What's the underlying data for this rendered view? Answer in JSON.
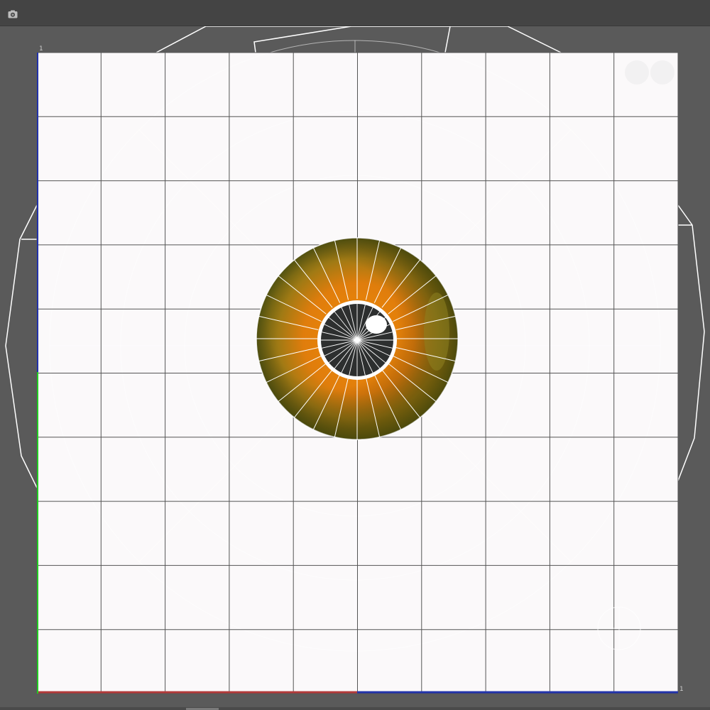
{
  "toolbar": {
    "snapshot_icon": "camera-icon"
  },
  "uv_editor": {
    "tile_label_top_left": "1",
    "tile_label_bottom_right": "1",
    "grid_divisions": 10,
    "grid_visible": true,
    "colors": {
      "background": "#5a5a5a",
      "canvas": "#fbf9fa",
      "grid_line": "#555555",
      "wire": "#ffffff",
      "axis_u_red": "#b23a3a",
      "axis_u_blue": "#2233aa",
      "axis_v_green": "#22cc22",
      "axis_v_blue": "#2233aa",
      "iris_orange": "#e8840a",
      "iris_olive": "#6f6a12",
      "pupil": "#2d2f2f",
      "highlight": "#ffffff"
    }
  },
  "nav_gizmo": {
    "icons": [
      "zoom-gizmo-icon",
      "pan-gizmo-icon"
    ]
  }
}
